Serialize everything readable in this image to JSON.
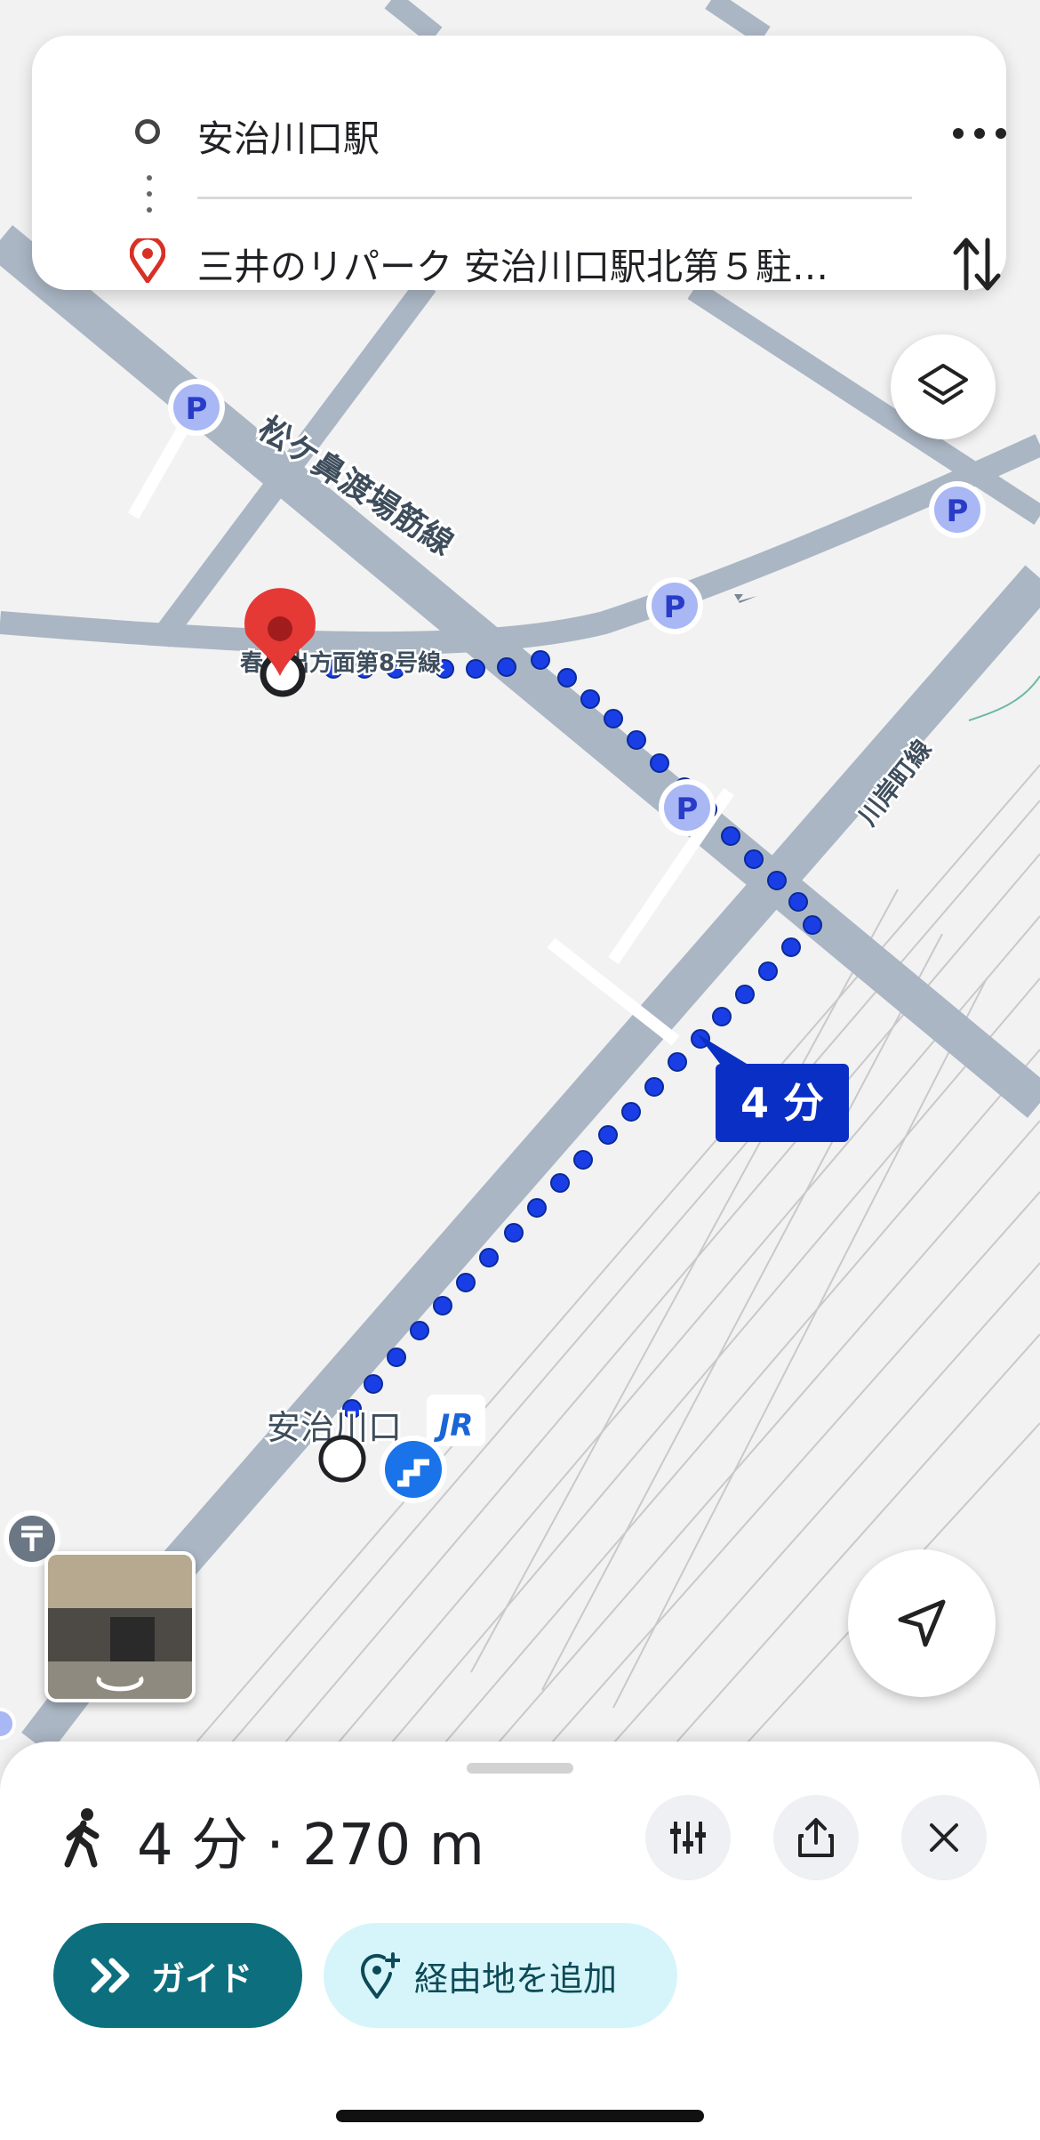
{
  "route": {
    "origin": "安治川口駅",
    "destination": "三井のリパーク 安治川口駅北第５駐…"
  },
  "map": {
    "road_labels": [
      "松ケ鼻渡場筋線",
      "春日出方面第8号線",
      "川岸町線"
    ],
    "station_label": "安治川口",
    "duration_badge": "4 分",
    "parking_label": "P",
    "jr_label": "JR",
    "route_color": "#1a3ee6",
    "road_color": "#aab6c4"
  },
  "summary": {
    "duration": "4 分",
    "separator": "·",
    "distance": "270 m"
  },
  "actions": {
    "guide_label": "ガイド",
    "add_stop_label": "経由地を追加"
  },
  "colors": {
    "accent": "#0d6f7e",
    "accent_light": "#d6f5fa",
    "pin_red": "#e53935",
    "badge_blue": "#0a2fc5"
  }
}
